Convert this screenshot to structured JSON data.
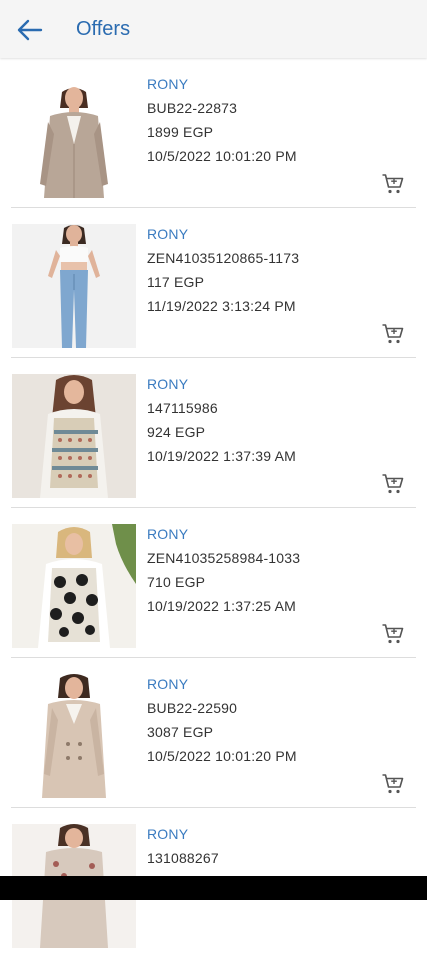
{
  "header": {
    "title": "Offers",
    "back_icon": "arrow-left-icon"
  },
  "colors": {
    "accent": "#2a6bb0",
    "brand_text": "#3a7bc0",
    "text": "#333333",
    "header_bg": "#f5f5f5"
  },
  "offers": [
    {
      "brand": "RONY",
      "code": "BUB22-22873",
      "price": "1899 EGP",
      "date": "10/5/2022 10:01:20 PM",
      "image": "woman in beige coat"
    },
    {
      "brand": "RONY",
      "code": "ZEN41035120865-1173",
      "price": "117 EGP",
      "date": "11/19/2022 3:13:24 PM",
      "image": "woman in white top and jeans"
    },
    {
      "brand": "RONY",
      "code": "147115986",
      "price": "924 EGP",
      "date": "10/19/2022 1:37:39 AM",
      "image": "woman in patterned sweater vest"
    },
    {
      "brand": "RONY",
      "code": "ZEN41035258984-1033",
      "price": "710 EGP",
      "date": "10/19/2022 1:37:25 AM",
      "image": "woman in black floral sweater vest"
    },
    {
      "brand": "RONY",
      "code": "BUB22-22590",
      "price": "3087 EGP",
      "date": "10/5/2022 10:01:20 PM",
      "image": "woman in beige coat"
    },
    {
      "brand": "RONY",
      "code": "131088267",
      "price": "",
      "date": "",
      "image": "woman in patterned jacket"
    }
  ]
}
